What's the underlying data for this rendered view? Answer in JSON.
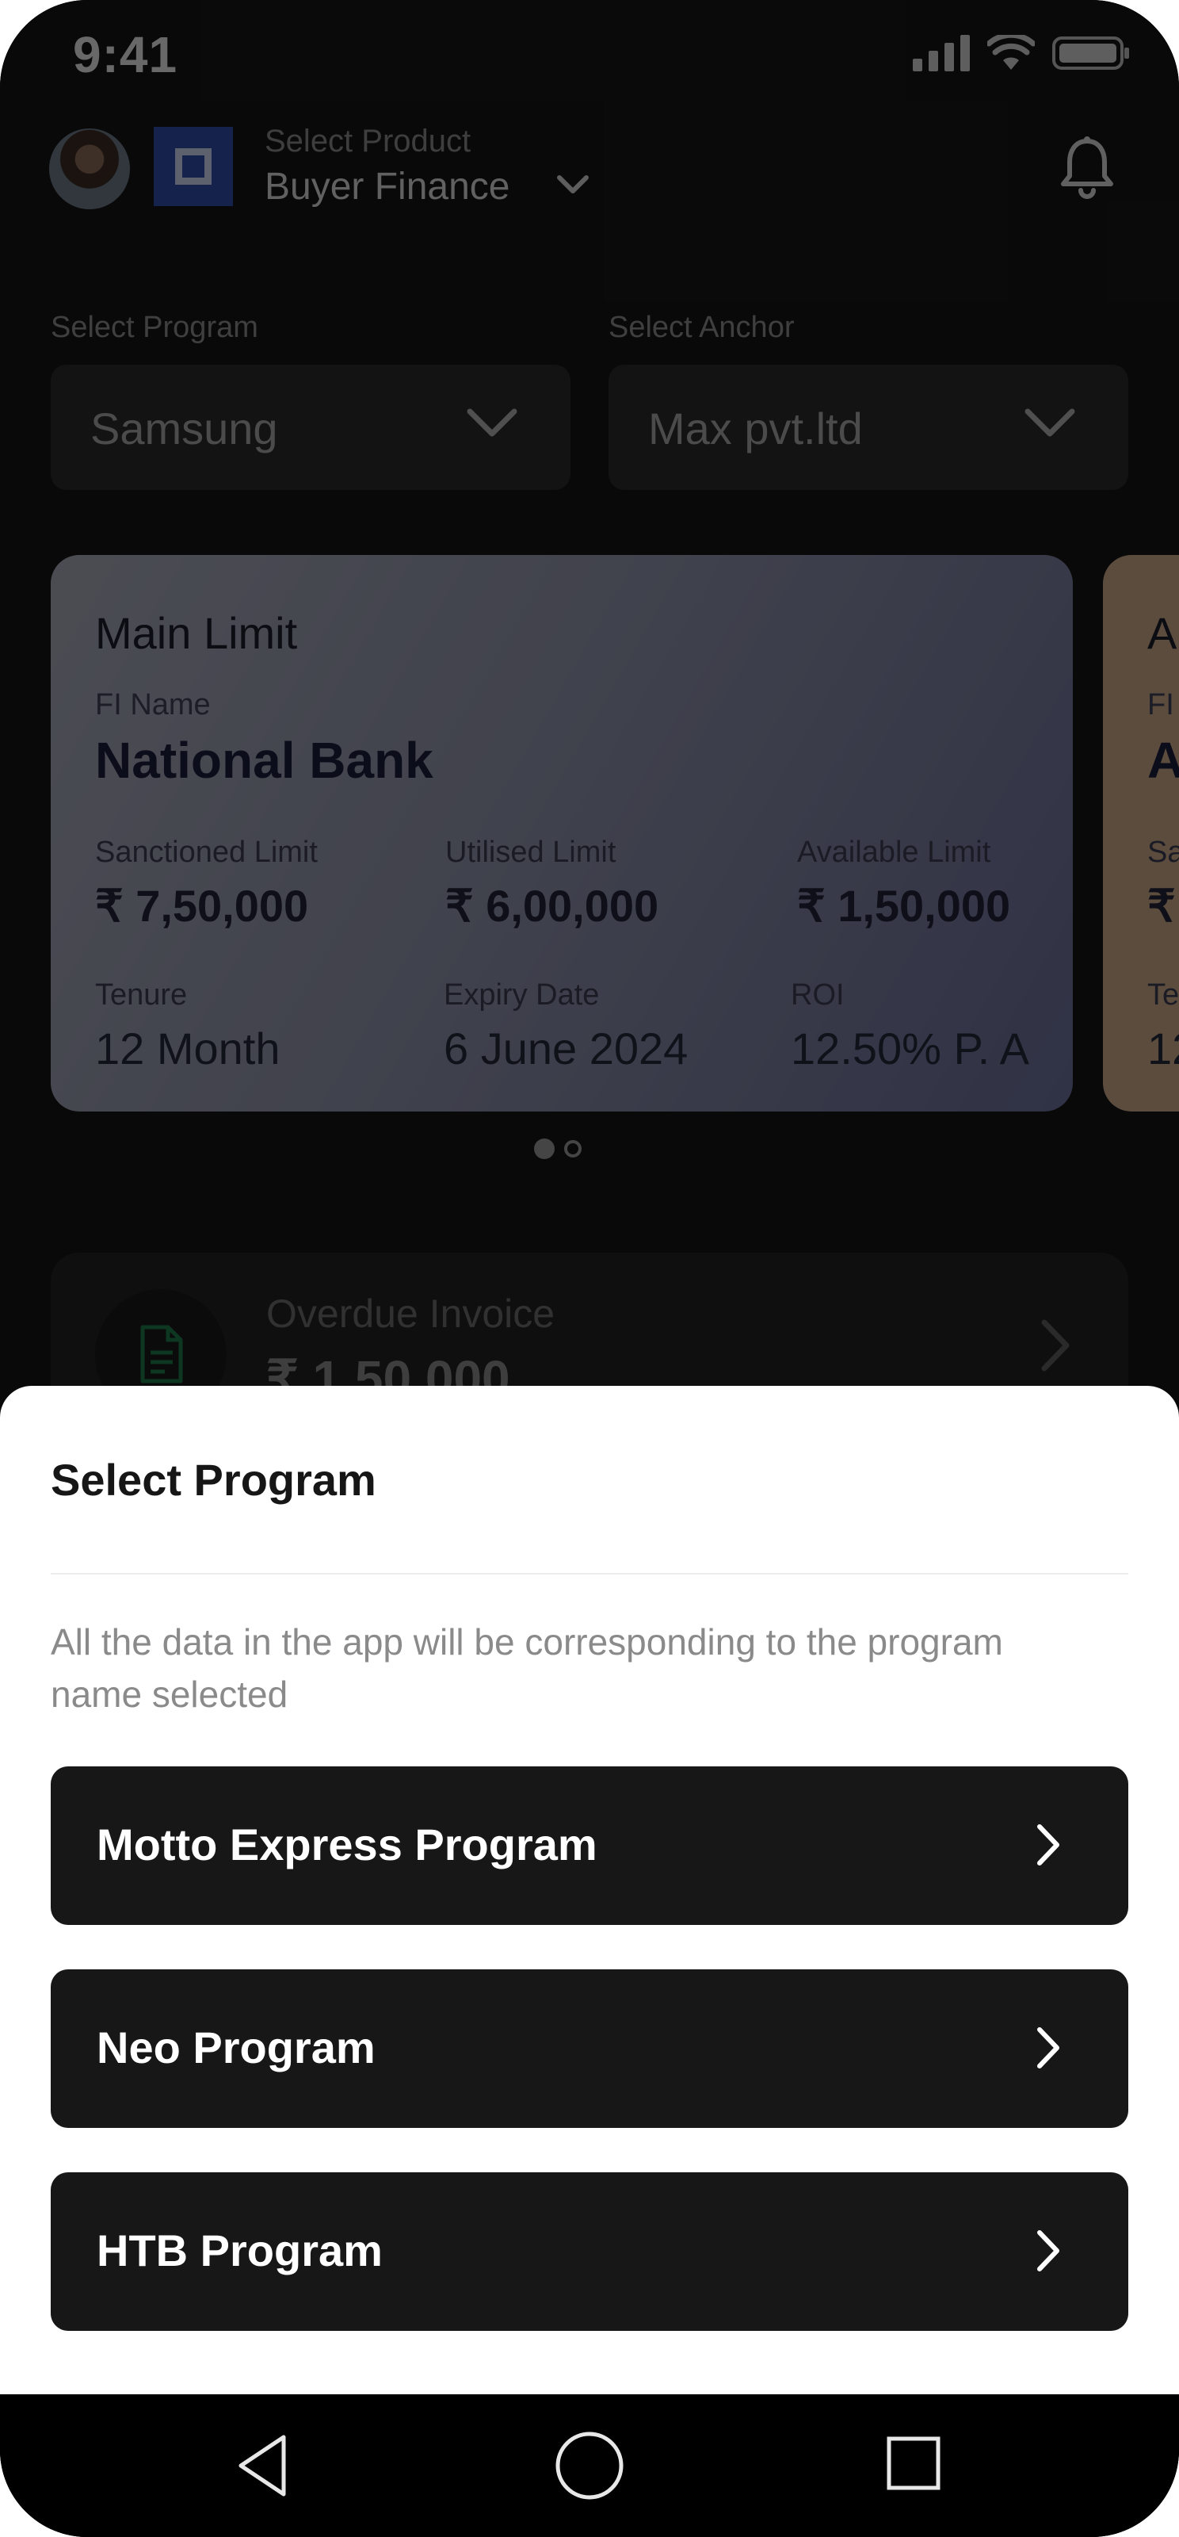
{
  "status_bar": {
    "time": "9:41"
  },
  "header": {
    "product_label": "Select Product",
    "product_value": "Buyer Finance"
  },
  "selectors": {
    "program": {
      "label": "Select Program",
      "value": "Samsung"
    },
    "anchor": {
      "label": "Select Anchor",
      "value": "Max pvt.ltd"
    }
  },
  "limit_card": {
    "title": "Main Limit",
    "fi_label": "FI Name",
    "fi_value": "National Bank",
    "stats": [
      {
        "label": "Sanctioned Limit",
        "value": "₹ 7,50,000"
      },
      {
        "label": "Utilised Limit",
        "value": "₹ 6,00,000"
      },
      {
        "label": "Available Limit",
        "value": "₹ 1,50,000"
      },
      {
        "label": "Tenure",
        "value": "12 Month"
      },
      {
        "label": "Expiry Date",
        "value": "6 June 2024"
      },
      {
        "label": "ROI",
        "value": "12.50% P. A"
      }
    ]
  },
  "next_card": {
    "title_partial": "A",
    "fi_label_partial": "FI",
    "fi_value_partial": "A",
    "stat_label_partial": "Sa",
    "stat_value_partial": "₹",
    "row2_label_partial": "Te",
    "row2_value_partial": "12"
  },
  "carousel": {
    "pages": 2,
    "active_index": 0
  },
  "overdue": {
    "label": "Overdue Invoice",
    "value": "₹ 1,50,000"
  },
  "sheet": {
    "title": "Select Program",
    "description": "All the data in the app will be corresponding to the program name selected",
    "programs": [
      {
        "label": "Motto Express Program"
      },
      {
        "label": "Neo Program"
      },
      {
        "label": "HTB Program"
      }
    ]
  },
  "nav_bar": {
    "icons": [
      "back-triangle-icon",
      "home-circle-icon",
      "recents-square-icon"
    ]
  },
  "colors": {
    "sheet_background": "#ffffff",
    "program_button": "#171717",
    "card_gradient_start": "#a7aab8",
    "card_gradient_end": "#6b6f9a",
    "logo_blue": "#2f4ea8"
  }
}
